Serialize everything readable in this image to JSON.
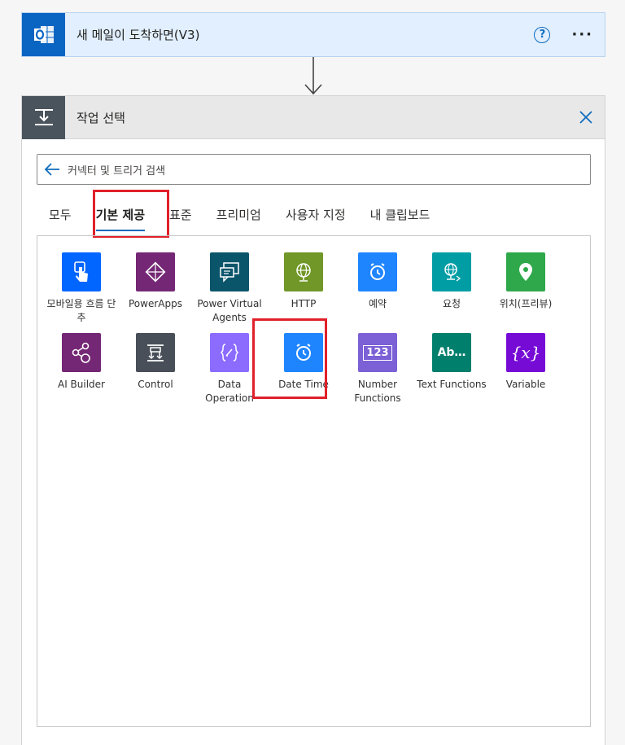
{
  "trigger": {
    "title": "새 메일이 도착하면(V3)",
    "help": "?",
    "more": "···"
  },
  "panel": {
    "title": "작업 선택"
  },
  "search": {
    "placeholder": "커넥터 및 트리거 검색"
  },
  "tabs": [
    "모두",
    "기본 제공",
    "표준",
    "프리미엄",
    "사용자 지정",
    "내 클립보드"
  ],
  "active_tab": "기본 제공",
  "tiles": [
    {
      "label": "모바일용 흐름 단추",
      "color": "#0066ff",
      "icon": "touch-icon"
    },
    {
      "label": "PowerApps",
      "color": "#742774",
      "icon": "powerapps-icon"
    },
    {
      "label": "Power Virtual Agents",
      "color": "#0b556a",
      "icon": "chat-bot-icon"
    },
    {
      "label": "HTTP",
      "color": "#709727",
      "icon": "globe-icon"
    },
    {
      "label": "예약",
      "color": "#1f85ff",
      "icon": "alarm-clock-icon"
    },
    {
      "label": "요청",
      "color": "#009da5",
      "icon": "request-icon"
    },
    {
      "label": "위치(프리뷰)",
      "color": "#2ea84a",
      "icon": "location-pin-icon"
    },
    {
      "label": "AI Builder",
      "color": "#742774",
      "icon": "ai-builder-icon"
    },
    {
      "label": "Control",
      "color": "#484f58",
      "icon": "control-icon"
    },
    {
      "label": "Data Operation",
      "color": "#8c6cff",
      "icon": "data-operation-icon"
    },
    {
      "label": "Date Time",
      "color": "#1f85ff",
      "icon": "alarm-clock-icon"
    },
    {
      "label": "Number Functions",
      "color": "#7c60d6",
      "icon": "number-123-icon"
    },
    {
      "label": "Text Functions",
      "color": "#007f6d",
      "icon": "text-ab-icon"
    },
    {
      "label": "Variable",
      "color": "#770bd6",
      "icon": "variable-x-icon"
    }
  ],
  "tile_glyphs": {
    "number": "123",
    "text": "Ab…",
    "variable": "{x}"
  }
}
